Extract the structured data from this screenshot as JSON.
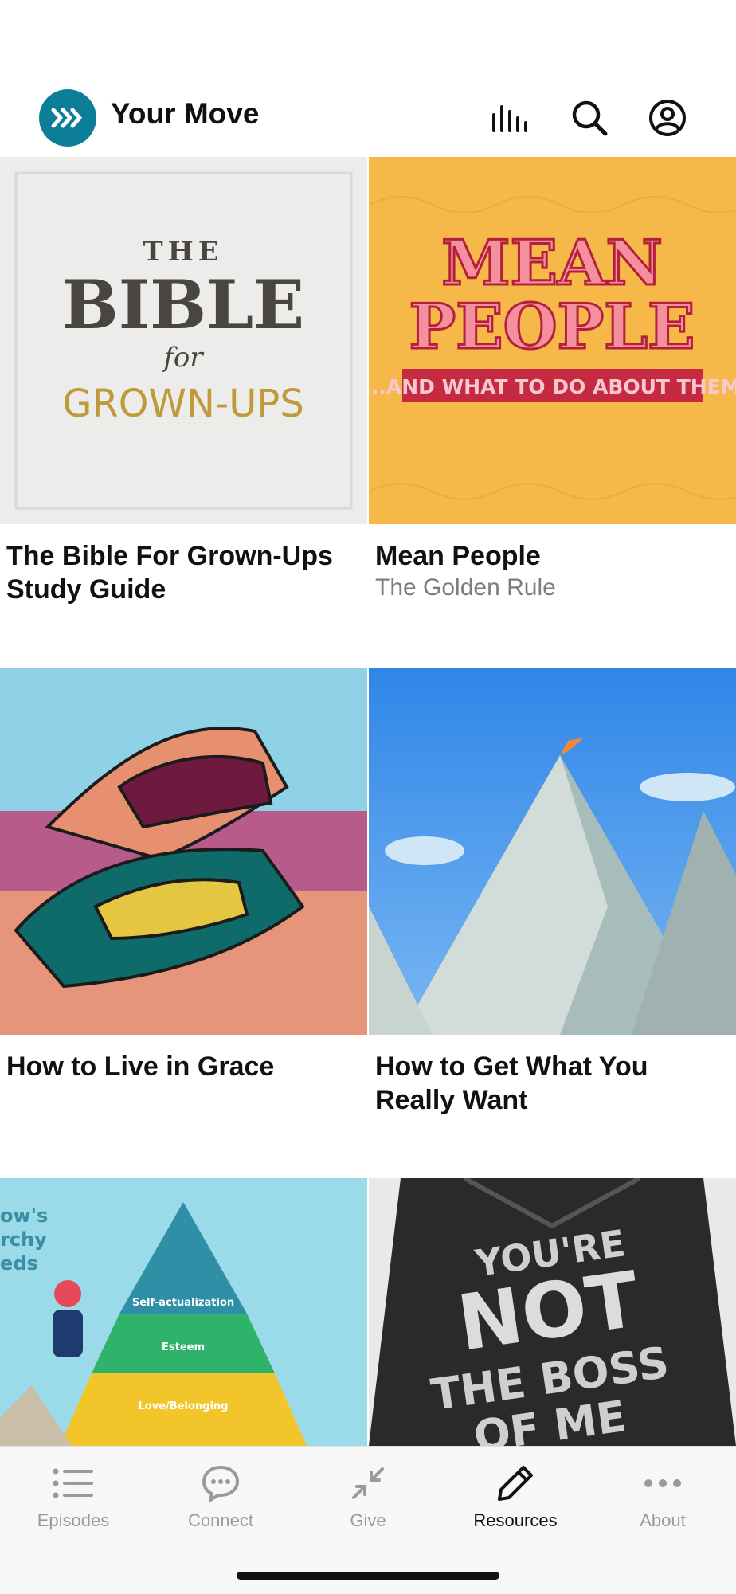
{
  "header": {
    "app_title": "Your Move",
    "icons": [
      "audio-bars-icon",
      "search-icon",
      "account-icon"
    ],
    "logo_icon": "chevrons-right-icon",
    "brand_color": "#0d7e98"
  },
  "cards": [
    {
      "title": "The Bible For Grown-Ups Study Guide",
      "subtitle": "",
      "art": {
        "line1": "THE",
        "line2": "BIBLE",
        "line3": "for",
        "line4": "GROWN-UPS"
      }
    },
    {
      "title": "Mean People",
      "subtitle": "The Golden Rule",
      "art": {
        "line1": "MEAN",
        "line2": "PEOPLE",
        "tagline": "...AND WHAT TO DO ABOUT THEM"
      }
    },
    {
      "title": "How to Live in Grace",
      "subtitle": ""
    },
    {
      "title": "How to Get What You Really Want",
      "subtitle": ""
    },
    {
      "title": "",
      "subtitle": "",
      "art": {
        "side1": "ow's",
        "side2": "rchy",
        "side3": "eds",
        "level1": "Self-actualization",
        "level2": "Esteem",
        "level3": "Love/Belonging"
      }
    },
    {
      "title": "",
      "subtitle": "",
      "art": {
        "line1": "YOU'RE",
        "line2": "NOT",
        "line3": "THE BOSS",
        "line4": "OF ME"
      }
    }
  ],
  "tabs": [
    {
      "label": "Episodes",
      "icon": "list-icon",
      "active": false
    },
    {
      "label": "Connect",
      "icon": "chat-bubble-icon",
      "active": false
    },
    {
      "label": "Give",
      "icon": "collapse-arrows-icon",
      "active": false
    },
    {
      "label": "Resources",
      "icon": "pencil-icon",
      "active": true
    },
    {
      "label": "About",
      "icon": "more-dots-icon",
      "active": false
    }
  ]
}
